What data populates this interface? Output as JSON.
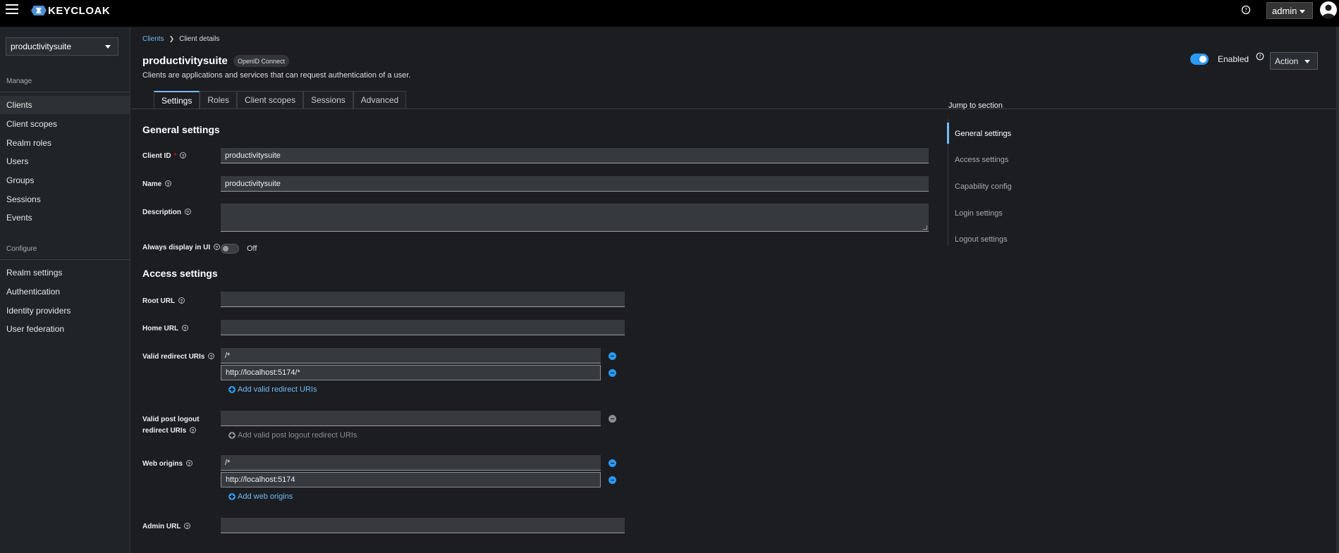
{
  "masthead": {
    "logo_text": "KEYCLOAK",
    "user_label": "admin"
  },
  "sidebar": {
    "realm": "productivitysuite",
    "manage_label": "Manage",
    "manage_items": [
      {
        "label": "Clients"
      },
      {
        "label": "Client scopes"
      },
      {
        "label": "Realm roles"
      },
      {
        "label": "Users"
      },
      {
        "label": "Groups"
      },
      {
        "label": "Sessions"
      },
      {
        "label": "Events"
      }
    ],
    "configure_label": "Configure",
    "configure_items": [
      {
        "label": "Realm settings"
      },
      {
        "label": "Authentication"
      },
      {
        "label": "Identity providers"
      },
      {
        "label": "User federation"
      }
    ]
  },
  "header": {
    "breadcrumb": {
      "parent": "Clients",
      "current": "Client details"
    },
    "title": "productivitysuite",
    "protocol_badge": "OpenID Connect",
    "description": "Clients are applications and services that can request authentication of a user.",
    "enabled_label": "Enabled",
    "action_label": "Action"
  },
  "tabs": [
    {
      "label": "Settings"
    },
    {
      "label": "Roles"
    },
    {
      "label": "Client scopes"
    },
    {
      "label": "Sessions"
    },
    {
      "label": "Advanced"
    }
  ],
  "general": {
    "title": "General settings",
    "client_id_label": "Client ID",
    "client_id_required": "*",
    "client_id_value": "productivitysuite",
    "name_label": "Name",
    "name_value": "productivitysuite",
    "description_label": "Description",
    "always_display_label": "Always display in UI",
    "always_display_state": "Off"
  },
  "access": {
    "title": "Access settings",
    "root_url_label": "Root URL",
    "home_url_label": "Home URL",
    "redirect_label": "Valid redirect URIs",
    "redirect_values": [
      "/*",
      "http://localhost:5174/*"
    ],
    "redirect_add": "Add valid redirect URIs",
    "logout_label_line1": "Valid post logout",
    "logout_label_line2": "redirect URIs",
    "logout_add": "Add valid post logout redirect URIs",
    "web_origins_label": "Web origins",
    "web_origins_values": [
      "/*",
      "http://localhost:5174"
    ],
    "web_origins_add": "Add web origins",
    "admin_url_label": "Admin URL"
  },
  "jump": {
    "title": "Jump to section",
    "items": [
      {
        "label": "General settings"
      },
      {
        "label": "Access settings"
      },
      {
        "label": "Capability config"
      },
      {
        "label": "Login settings"
      },
      {
        "label": "Logout settings"
      }
    ]
  },
  "colors": {
    "accent": "#2b9af3",
    "link": "#73bcf7",
    "masthead": "#000000"
  }
}
